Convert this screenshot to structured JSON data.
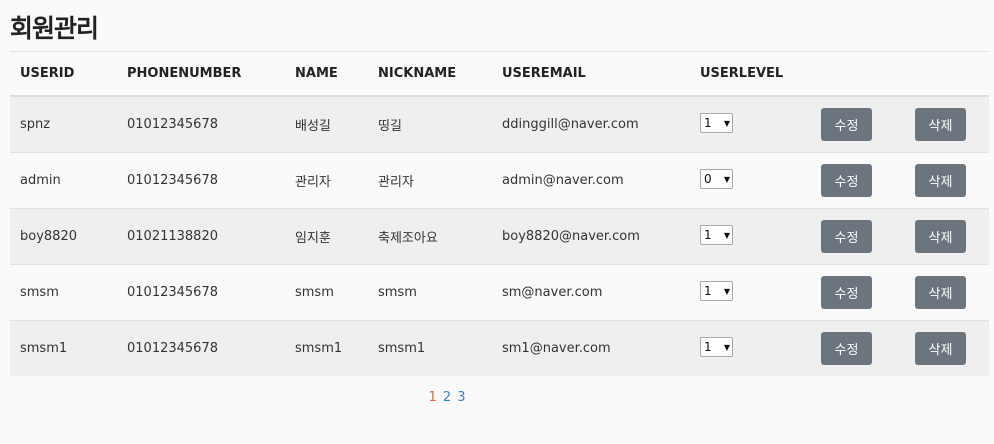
{
  "page": {
    "title": "회원관리"
  },
  "table": {
    "columns": [
      "USERID",
      "PHONENUMBER",
      "NAME",
      "NICKNAME",
      "USEREMAIL",
      "USERLEVEL"
    ],
    "rows": [
      {
        "userid": "spnz",
        "phone": "01012345678",
        "name": "배성길",
        "nickname": "띵길",
        "email": "ddinggill@naver.com",
        "level": "1"
      },
      {
        "userid": "admin",
        "phone": "01012345678",
        "name": "관리자",
        "nickname": "관리자",
        "email": "admin@naver.com",
        "level": "0"
      },
      {
        "userid": "boy8820",
        "phone": "01021138820",
        "name": "임지훈",
        "nickname": "축제조아요",
        "email": "boy8820@naver.com",
        "level": "1"
      },
      {
        "userid": "smsm",
        "phone": "01012345678",
        "name": "smsm",
        "nickname": "smsm",
        "email": "sm@naver.com",
        "level": "1"
      },
      {
        "userid": "smsm1",
        "phone": "01012345678",
        "name": "smsm1",
        "nickname": "smsm1",
        "email": "sm1@naver.com",
        "level": "1"
      }
    ],
    "edit_label": "수정",
    "delete_label": "삭제"
  },
  "pagination": {
    "pages": [
      "1",
      "2",
      "3"
    ],
    "current": "1"
  },
  "colors": {
    "button_bg": "#6c757d",
    "current_page": "#e06a3b",
    "page_link": "#3b82c4"
  }
}
